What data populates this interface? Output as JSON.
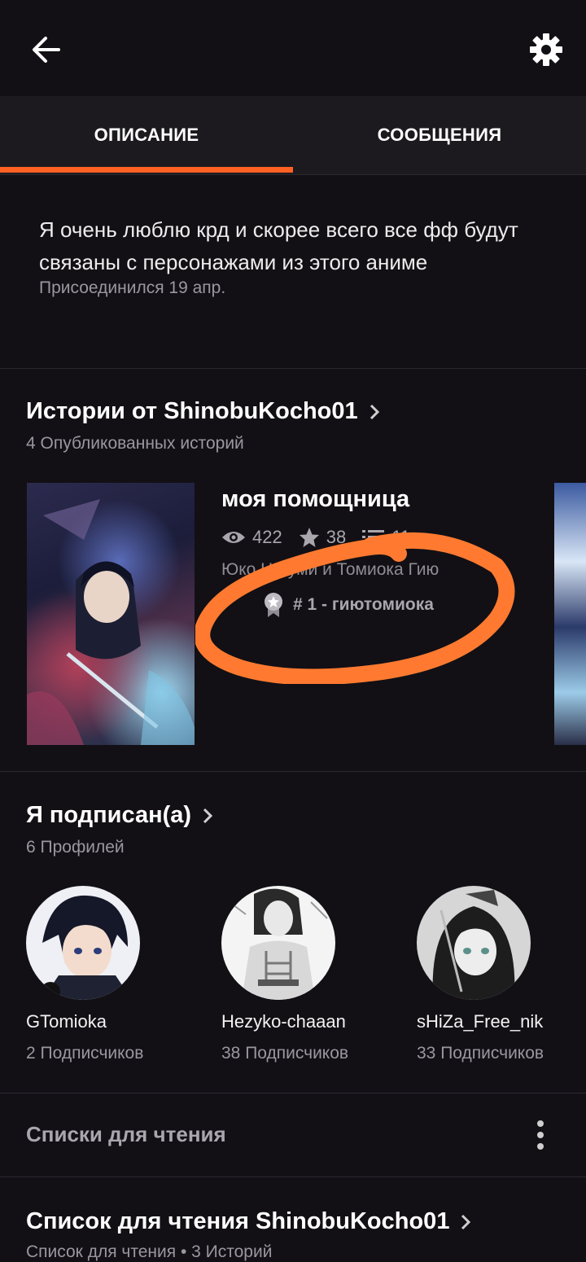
{
  "tabs": [
    {
      "label": "ОПИСАНИЕ",
      "active": true
    },
    {
      "label": "СООБЩЕНИЯ",
      "active": false
    }
  ],
  "about": {
    "text": "Я очень люблю крд и скорее всего все фф будут связаны с персонажами из этого аниме",
    "joined": "Присоединился 19 апр."
  },
  "stories": {
    "title": "Истории от ShinobuKocho01",
    "subtitle": "4 Опубликованных историй",
    "items": [
      {
        "title": "моя помощница",
        "views": "422",
        "votes": "38",
        "parts": "11",
        "tags": "Юко Цугуми и Томиока Гию",
        "rank": "# 1 - гиютомиока"
      }
    ]
  },
  "following": {
    "title": "Я подписан(а)",
    "subtitle": "6 Профилей",
    "profiles": [
      {
        "name": "GTomioka",
        "followers": "2 Подписчиков"
      },
      {
        "name": "Hezyko-chaaan",
        "followers": "38 Подписчиков"
      },
      {
        "name": "sHiZa_Free_nik",
        "followers": "33 Подписчиков"
      }
    ]
  },
  "reading_lists": {
    "title": "Списки для чтения",
    "list_title": "Список для чтения ShinobuKocho01",
    "list_subtitle": "Список для чтения • 3 Историй"
  },
  "colors": {
    "accent": "#ff6122",
    "background": "#121015"
  },
  "icons": [
    "back-arrow-icon",
    "gear-icon",
    "eye-icon",
    "star-icon",
    "list-icon",
    "award-icon",
    "chevron-right-icon",
    "kebab-menu-icon"
  ]
}
